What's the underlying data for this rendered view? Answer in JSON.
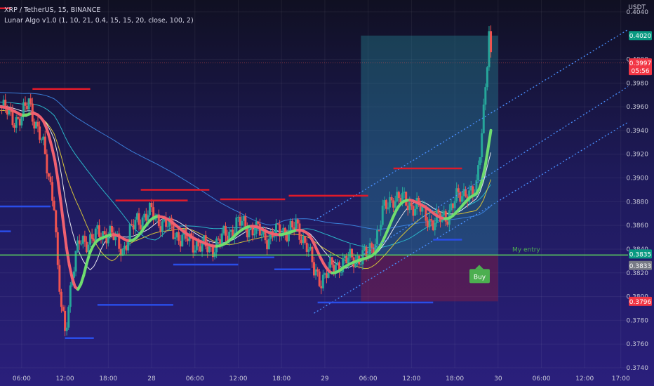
{
  "header": {
    "symbol": "XRP / TetherUS, 15, BINANCE",
    "indicator": "Lunar Algo v1.0 (1, 10, 21, 0.4, 15, 15, 20, close, 100, 2)",
    "currency": "USDT"
  },
  "chart_data": {
    "type": "candlestick",
    "symbol": "XRP / TetherUS",
    "interval": "15",
    "exchange": "BINANCE",
    "ylim": [
      0.374,
      0.405
    ],
    "y_ticks": [
      0.404,
      0.4,
      0.398,
      0.396,
      0.394,
      0.392,
      0.39,
      0.388,
      0.386,
      0.384,
      0.382,
      0.38,
      0.378,
      0.376,
      0.374
    ],
    "xlim": [
      "27 03:00",
      "30 18:00"
    ],
    "x_ticks": [
      {
        "label": "06:00",
        "t": "27 06:00"
      },
      {
        "label": "12:00",
        "t": "27 12:00"
      },
      {
        "label": "18:00",
        "t": "27 18:00"
      },
      {
        "label": "28",
        "t": "28 00:00"
      },
      {
        "label": "06:00",
        "t": "28 06:00"
      },
      {
        "label": "12:00",
        "t": "28 12:00"
      },
      {
        "label": "18:00",
        "t": "28 18:00"
      },
      {
        "label": "29",
        "t": "29 00:00"
      },
      {
        "label": "06:00",
        "t": "29 06:00"
      },
      {
        "label": "12:00",
        "t": "29 12:00"
      },
      {
        "label": "18:00",
        "t": "29 18:00"
      },
      {
        "label": "30",
        "t": "30 00:00"
      },
      {
        "label": "06:00",
        "t": "30 06:00"
      },
      {
        "label": "12:00",
        "t": "30 12:00"
      },
      {
        "label": "17:00",
        "t": "30 17:00"
      }
    ],
    "price_path": [
      [
        "27 03:00",
        0.396
      ],
      [
        "27 05:00",
        0.395
      ],
      [
        "27 06:00",
        0.395
      ],
      [
        "27 07:00",
        0.3965
      ],
      [
        "27 08:00",
        0.3945
      ],
      [
        "27 09:00",
        0.3925
      ],
      [
        "27 10:30",
        0.388
      ],
      [
        "27 11:00",
        0.382
      ],
      [
        "27 11:30",
        0.379
      ],
      [
        "27 12:00",
        0.377
      ],
      [
        "27 13:00",
        0.382
      ],
      [
        "27 14:00",
        0.3845
      ],
      [
        "27 16:00",
        0.385
      ],
      [
        "27 18:00",
        0.3855
      ],
      [
        "27 20:00",
        0.384
      ],
      [
        "27 22:00",
        0.3865
      ],
      [
        "28 00:00",
        0.387
      ],
      [
        "28 02:00",
        0.386
      ],
      [
        "28 04:00",
        0.385
      ],
      [
        "28 06:00",
        0.3845
      ],
      [
        "28 08:00",
        0.384
      ],
      [
        "28 10:00",
        0.385
      ],
      [
        "28 12:00",
        0.3862
      ],
      [
        "28 14:00",
        0.3857
      ],
      [
        "28 16:00",
        0.385
      ],
      [
        "28 18:00",
        0.3855
      ],
      [
        "28 20:00",
        0.3858
      ],
      [
        "28 21:30",
        0.3845
      ],
      [
        "28 22:30",
        0.382
      ],
      [
        "28 23:30",
        0.3815
      ],
      [
        "29 00:30",
        0.3822
      ],
      [
        "29 02:00",
        0.3828
      ],
      [
        "29 04:00",
        0.3832
      ],
      [
        "29 06:00",
        0.3835
      ],
      [
        "29 07:00",
        0.3848
      ],
      [
        "29 08:00",
        0.387
      ],
      [
        "29 09:30",
        0.3885
      ],
      [
        "29 11:00",
        0.388
      ],
      [
        "29 13:00",
        0.3875
      ],
      [
        "29 15:00",
        0.3862
      ],
      [
        "29 17:00",
        0.387
      ],
      [
        "29 18:00",
        0.388
      ],
      [
        "29 19:30",
        0.389
      ],
      [
        "29 20:30",
        0.3885
      ],
      [
        "29 21:00",
        0.389
      ],
      [
        "29 21:30",
        0.3925
      ],
      [
        "29 22:00",
        0.396
      ],
      [
        "29 22:45",
        0.402
      ],
      [
        "29 23:00",
        0.3997
      ]
    ],
    "position": {
      "entry": 0.3835,
      "take_profit": 0.402,
      "stop_loss": 0.3796,
      "start": "29 05:00",
      "end": "30 00:00"
    },
    "resistance_lines": [
      {
        "y": 0.4043,
        "x0": "27 03:00",
        "x1": "27 04:30"
      },
      {
        "y": 0.3975,
        "x0": "27 07:30",
        "x1": "27 15:30"
      },
      {
        "y": 0.389,
        "x0": "27 22:30",
        "x1": "28 08:00"
      },
      {
        "y": 0.3881,
        "x0": "27 19:00",
        "x1": "28 05:00"
      },
      {
        "y": 0.3882,
        "x0": "28 09:30",
        "x1": "28 18:30"
      },
      {
        "y": 0.3885,
        "x0": "28 19:00",
        "x1": "29 06:00"
      },
      {
        "y": 0.3908,
        "x0": "29 09:30",
        "x1": "29 19:00"
      }
    ],
    "support_lines": [
      {
        "y": 0.3876,
        "x0": "27 01:00",
        "x1": "27 10:00"
      },
      {
        "y": 0.3855,
        "x0": "27 00:00",
        "x1": "27 04:30"
      },
      {
        "y": 0.3765,
        "x0": "27 12:00",
        "x1": "27 16:00"
      },
      {
        "y": 0.3793,
        "x0": "27 16:30",
        "x1": "28 03:00"
      },
      {
        "y": 0.3827,
        "x0": "28 03:00",
        "x1": "28 12:00"
      },
      {
        "y": 0.3833,
        "x0": "28 12:00",
        "x1": "28 17:00"
      },
      {
        "y": 0.3823,
        "x0": "28 17:00",
        "x1": "28 22:00"
      },
      {
        "y": 0.3795,
        "x0": "28 23:00",
        "x1": "29 15:00"
      },
      {
        "y": 0.3848,
        "x0": "29 15:00",
        "x1": "29 19:00"
      }
    ],
    "channel_lines": [
      {
        "p0": [
          "28 22:30",
          0.3786
        ],
        "p1": [
          "30 18:00",
          0.3947
        ]
      },
      {
        "p0": [
          "28 22:30",
          0.3864
        ],
        "p1": [
          "30 18:00",
          0.4025
        ]
      },
      {
        "p0": [
          "29 05:00",
          0.3834
        ],
        "p1": [
          "30 18:00",
          0.3977
        ]
      }
    ],
    "current_price": 0.3997,
    "price_labels": [
      {
        "value": "0.4020",
        "color": "#089981"
      },
      {
        "value": "0.3997",
        "sub": "05:56",
        "color": "#f23645"
      },
      {
        "value": "0.3835",
        "color": "#089981"
      },
      {
        "value": "0.3833",
        "color": "#787b86"
      },
      {
        "value": "0.3796",
        "color": "#f23645"
      }
    ],
    "annotations": [
      {
        "text": "My entry",
        "color": "#4caf50"
      },
      {
        "text": "Buy",
        "color": "#4caf50"
      }
    ]
  }
}
